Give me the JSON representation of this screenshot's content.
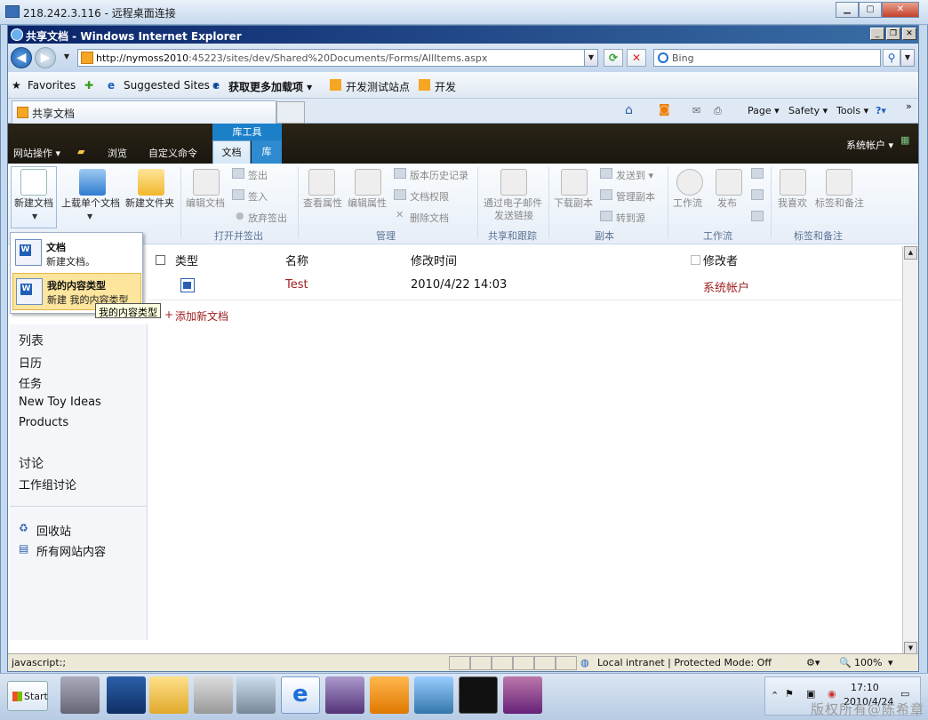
{
  "rdp": {
    "title": "218.242.3.116 - 远程桌面连接"
  },
  "ie": {
    "title": "共享文档 - Windows Internet Explorer",
    "address": {
      "host": "http://nymoss2010",
      "rest": ":45223/sites/dev/Shared%20Documents/Forms/AllItems.aspx"
    },
    "search_placeholder": "Bing",
    "favorites": {
      "favorites_label": "Favorites",
      "items": [
        "Suggested Sites ▾",
        "获取更多加载项 ▾",
        "开发测试站点",
        "开发"
      ]
    },
    "tab_label": "共享文档",
    "command_bar": [
      "Page ▾",
      "Safety ▾",
      "Tools ▾"
    ]
  },
  "sp": {
    "context_group": "库工具",
    "tabs": [
      "网站操作 ▾",
      "浏览",
      "自定义命令",
      "文档",
      "库"
    ],
    "user": "系统帐户 ▾",
    "ribbon": {
      "big_buttons": [
        "新建文档",
        "上载单个文档",
        "新建文件夹",
        "编辑文档",
        "查看属性",
        "编辑属性",
        "通过电子邮件",
        "发送链接",
        "下载副本",
        "工作流",
        "发布",
        "我喜欢",
        "标签和备注"
      ],
      "small_buttons": [
        "签出",
        "签入",
        "放弃签出",
        "版本历史记录",
        "文档权限",
        "删除文档",
        "发送到 ▾",
        "管理副本",
        "转到源"
      ],
      "groups": [
        "打开并签出",
        "管理",
        "共享和跟踪",
        "副本",
        "工作流",
        "标签和备注"
      ]
    },
    "new_menu": [
      {
        "title": "文档",
        "desc": "新建文档。"
      },
      {
        "title": "我的内容类型",
        "desc": "新建 我的内容类型"
      }
    ],
    "tooltip": "我的内容类型",
    "list": {
      "headers": [
        "类型",
        "名称",
        "修改时间",
        "修改者"
      ],
      "rows": [
        {
          "name": "Test",
          "modified": "2010/4/22 14:03",
          "modified_by": "系统帐户"
        }
      ],
      "add_new": "添加新文档"
    },
    "left_nav": {
      "lists_heading": "列表",
      "lists": [
        "日历",
        "任务",
        "New Toy Ideas",
        "Products"
      ],
      "discussions_heading": "讨论",
      "discussions": [
        "工作组讨论"
      ],
      "recycle": "回收站",
      "all_content": "所有网站内容"
    }
  },
  "status": {
    "left": "javascript:;",
    "zone": "Local intranet | Protected Mode: Off",
    "zoom": "100%"
  },
  "taskbar": {
    "start": "Start",
    "time": "17:10",
    "date": "2010/4/24"
  },
  "watermark": "版权所有@陈希章"
}
